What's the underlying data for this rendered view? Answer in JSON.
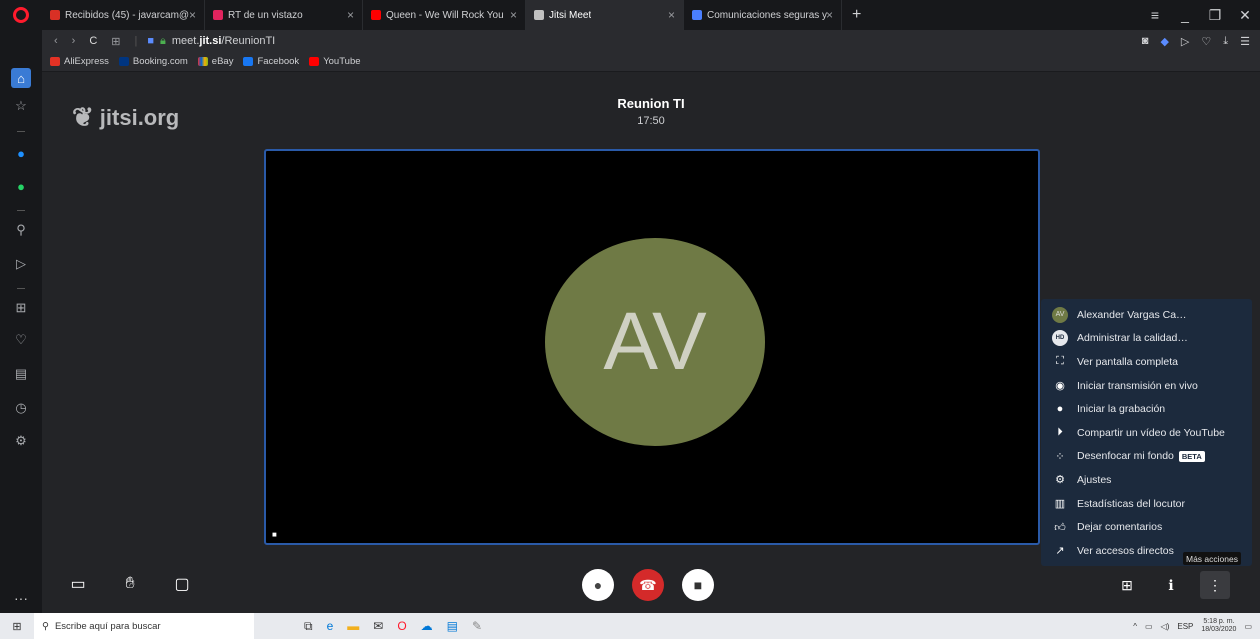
{
  "browser": {
    "tabs": [
      {
        "label": "Recibidos (45) - javarcam@",
        "color": "#d93025"
      },
      {
        "label": "RT de un vistazo",
        "color": "#e0245e"
      },
      {
        "label": "Queen - We Will Rock You",
        "color": "#ff0000"
      },
      {
        "label": "Jitsi Meet",
        "color": "#c0c0c0"
      },
      {
        "label": "Comunicaciones seguras y",
        "color": "#4a7fff"
      }
    ],
    "new_tab": "+",
    "url_host": "meet.jit.si",
    "url_prefix": "meet.",
    "url_bold": "jit.si",
    "url_path": "/ReunionTI",
    "bookmarks": [
      {
        "label": "AliExpress",
        "color": "#e43225"
      },
      {
        "label": "Booking.com",
        "color": "#003580"
      },
      {
        "label": "eBay",
        "color": "#e53238"
      },
      {
        "label": "Facebook",
        "color": "#1877f2"
      },
      {
        "label": "YouTube",
        "color": "#ff0000"
      }
    ]
  },
  "jitsi": {
    "logo": "jitsi.org",
    "meeting_title": "Reunion TI",
    "meeting_time": "17:50",
    "avatar_initials": "AV"
  },
  "menu": {
    "items": [
      {
        "label": "Alexander Vargas Ca…",
        "icon": "avatar-mini-icon"
      },
      {
        "label": "Administrar la calidad…",
        "icon": "hd-icon"
      },
      {
        "label": "Ver pantalla completa",
        "icon": "fullscreen-icon"
      },
      {
        "label": "Iniciar transmisión en vivo",
        "icon": "livestream-icon"
      },
      {
        "label": "Iniciar la grabación",
        "icon": "record-icon"
      },
      {
        "label": "Compartir un vídeo de YouTube",
        "icon": "play-icon"
      },
      {
        "label": "Desenfocar mi fondo",
        "icon": "blur-icon",
        "badge": "BETA"
      },
      {
        "label": "Ajustes",
        "icon": "gear-icon"
      },
      {
        "label": "Estadísticas del locutor",
        "icon": "stats-icon"
      },
      {
        "label": "Dejar comentarios",
        "icon": "thumbs-up-icon"
      },
      {
        "label": "Ver accesos directos",
        "icon": "shortcuts-icon"
      }
    ],
    "tooltip": "Más acciones"
  },
  "taskbar": {
    "search_placeholder": "Escribe aquí para buscar",
    "time": "5:18 p. m.",
    "date": "18/03/2020",
    "lang": "ESP"
  },
  "colors": {
    "accent_border": "#2a5aa8",
    "menu_bg": "#1c2a3d",
    "avatar_bg": "#6f7a45",
    "hangup": "#d42a2a"
  }
}
